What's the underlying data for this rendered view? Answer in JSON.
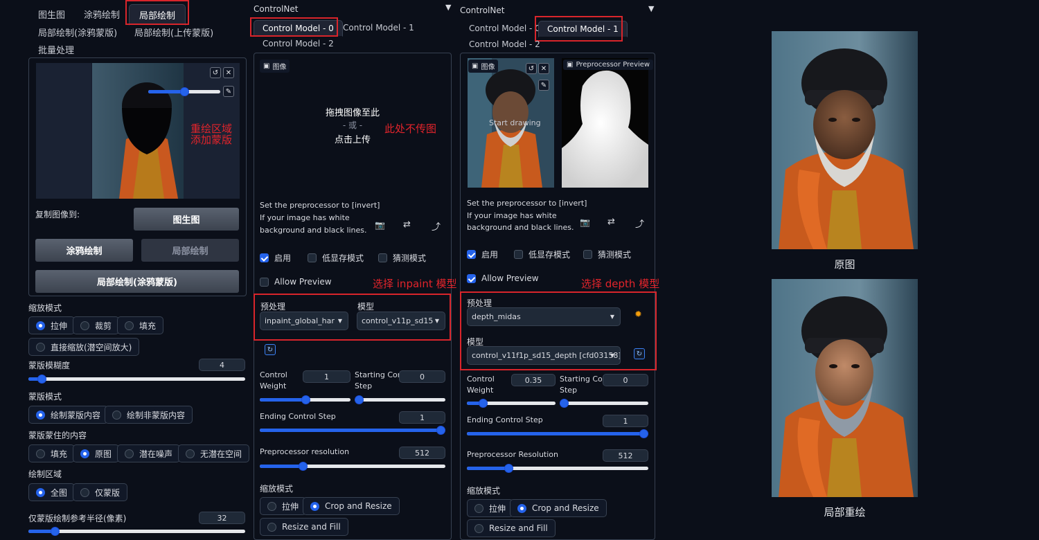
{
  "left": {
    "tabs": [
      "图生图",
      "涂鸦绘制",
      "局部绘制"
    ],
    "subtabs": [
      "局部绘制(涂鸦蒙版)",
      "局部绘制(上传蒙版)",
      "批量处理"
    ],
    "mask_note_line1": "重绘区域",
    "mask_note_line2": "添加蒙版",
    "copy_to_label": "复制图像到:",
    "btn_img2img": "图生图",
    "btn_sketch": "涂鸦绘制",
    "btn_inpaint": "局部绘制",
    "btn_inpaint_sketch": "局部绘制(涂鸦蒙版)",
    "resize_mode_label": "缩放模式",
    "resize_modes": [
      "拉伸",
      "裁剪",
      "填充",
      "直接缩放(潜空间放大)"
    ],
    "mask_blur_label": "蒙版模糊度",
    "mask_blur_value": "4",
    "mask_blur_fraction": 0.06,
    "mask_mode_label": "蒙版模式",
    "mask_modes": [
      "绘制蒙版内容",
      "绘制非蒙版内容"
    ],
    "masked_content_label": "蒙版蒙住的内容",
    "masked_contents": [
      "填充",
      "原图",
      "潜在噪声",
      "无潜在空间"
    ],
    "inpaint_area_label": "绘制区域",
    "inpaint_areas": [
      "全图",
      "仅蒙版"
    ],
    "padding_label": "仅蒙版绘制参考半径(像素)",
    "padding_value": "32",
    "padding_fraction": 0.12
  },
  "cn0": {
    "title": "ControlNet",
    "tabs": [
      "Control Model - 0",
      "Control Model - 1",
      "Control Model - 2"
    ],
    "image_label": "图像",
    "drop_line1": "拖拽图像至此",
    "drop_line2": "- 或 -",
    "drop_line3": "点击上传",
    "no_upload_note": "此处不传图",
    "hint_line1": "Set the preprocessor to [invert]",
    "hint_line2": "If your image has white",
    "hint_line3": "background and black lines.",
    "enable_label": "启用",
    "lowvram_label": "低显存模式",
    "guess_label": "猜测模式",
    "allow_preview_label": "Allow Preview",
    "select_note": "选择 inpaint 模型",
    "preprocessor_label": "预处理",
    "preprocessor_value": "inpaint_global_har",
    "model_label": "模型",
    "model_value": "control_v11p_sd15",
    "weight_label_1": "Control",
    "weight_label_2": "Weight",
    "weight_value": "1",
    "weight_fraction": 0.5,
    "start_label_1": "Starting Control",
    "start_label_2": "Step",
    "start_value": "0",
    "start_fraction": 0.0,
    "end_label": "Ending Control Step",
    "end_value": "1",
    "end_fraction": 1.0,
    "res_label": "Preprocessor resolution",
    "res_value": "512",
    "res_fraction": 0.23,
    "resize_label": "缩放模式",
    "resize_modes": [
      "拉伸",
      "Crop and Resize",
      "Resize and Fill"
    ]
  },
  "cn1": {
    "title": "ControlNet",
    "tabs": [
      "Control Model - 0",
      "Control Model - 1",
      "Control Model - 2"
    ],
    "image_label": "图像",
    "preview_label": "Preprocessor Preview",
    "start_drawing": "Start drawing",
    "hint_line1": "Set the preprocessor to [invert]",
    "hint_line2": "If your image has white",
    "hint_line3": "background and black lines.",
    "enable_label": "启用",
    "lowvram_label": "低显存模式",
    "guess_label": "猜测模式",
    "allow_preview_label": "Allow Preview",
    "select_note": "选择 depth 模型",
    "preprocessor_label": "预处理",
    "preprocessor_value": "depth_midas",
    "model_label": "模型",
    "model_value": "control_v11f1p_sd15_depth [cfd03158]",
    "weight_label_1": "Control",
    "weight_label_2": "Weight",
    "weight_value": "0.35",
    "weight_fraction": 0.18,
    "start_label_1": "Starting Control",
    "start_label_2": "Step",
    "start_value": "0",
    "start_fraction": 0.0,
    "end_label": "Ending Control Step",
    "end_value": "1",
    "end_fraction": 1.0,
    "res_label": "Preprocessor Resolution",
    "res_value": "512",
    "res_fraction": 0.23,
    "resize_label": "缩放模式",
    "resize_modes": [
      "拉伸",
      "Crop and Resize",
      "Resize and Fill"
    ]
  },
  "results": {
    "original_caption": "原图",
    "inpaint_caption": "局部重绘"
  }
}
